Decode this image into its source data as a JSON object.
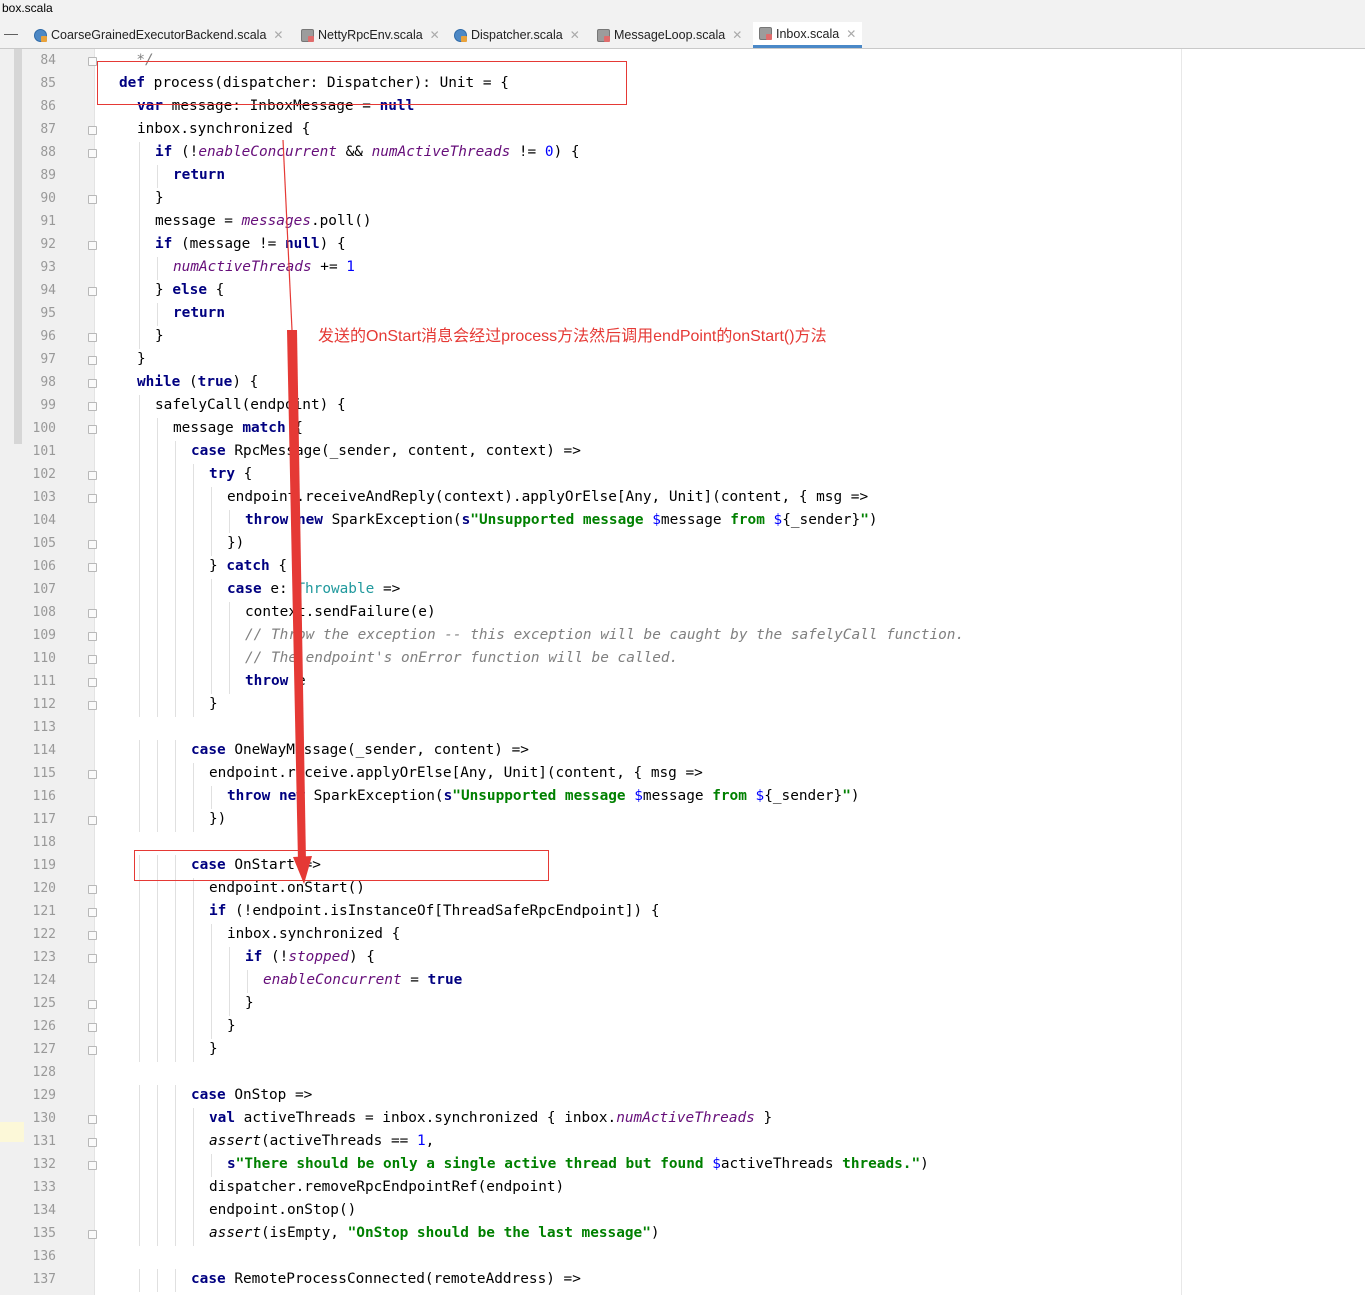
{
  "window": {
    "title": "box.scala"
  },
  "tabs": [
    {
      "label": "CoarseGrainedExecutorBackend.scala",
      "icon": "scala-class-icon",
      "active": false
    },
    {
      "label": "NettyRpcEnv.scala",
      "icon": "scala-object-icon",
      "active": false
    },
    {
      "label": "Dispatcher.scala",
      "icon": "scala-class-icon",
      "active": false
    },
    {
      "label": "MessageLoop.scala",
      "icon": "scala-object-icon",
      "active": false
    },
    {
      "label": "Inbox.scala",
      "icon": "scala-object-icon",
      "active": true
    }
  ],
  "annotation": {
    "text": "发送的OnStart消息会经过process方法然后调用endPoint的onStart()方法",
    "color": "#e53935"
  },
  "colors": {
    "keyword": "#000080",
    "field": "#660e7a",
    "number": "#0000ff",
    "string": "#008000",
    "comment": "#808080",
    "type": "#20999d",
    "annotation": "#e53935",
    "active_tab_underline": "#4a88c7"
  },
  "code_lines": [
    {
      "n": "84",
      "fold": true,
      "indent": 0,
      "t": [
        [
          "cmt",
          "  */"
        ]
      ]
    },
    {
      "n": "85",
      "fold": false,
      "indent": 0,
      "t": [
        [
          "kw",
          "def "
        ],
        [
          "",
          "process(dispatcher: Dispatcher): Unit = {"
        ]
      ]
    },
    {
      "n": "86",
      "fold": false,
      "indent": 1,
      "t": [
        [
          "kw",
          "var "
        ],
        [
          "",
          "message: InboxMessage = "
        ],
        [
          "kw",
          "null"
        ]
      ]
    },
    {
      "n": "87",
      "fold": true,
      "indent": 1,
      "t": [
        [
          "",
          "inbox.synchronized {"
        ]
      ]
    },
    {
      "n": "88",
      "fold": true,
      "indent": 2,
      "t": [
        [
          "kw",
          "if "
        ],
        [
          "",
          "(!"
        ],
        [
          "fld",
          "enableConcurrent"
        ],
        [
          "",
          " && "
        ],
        [
          "fld",
          "numActiveThreads"
        ],
        [
          "",
          " != "
        ],
        [
          "num",
          "0"
        ],
        [
          "",
          ") {"
        ]
      ]
    },
    {
      "n": "89",
      "fold": false,
      "indent": 3,
      "t": [
        [
          "kw",
          "return"
        ]
      ]
    },
    {
      "n": "90",
      "fold": true,
      "indent": 2,
      "t": [
        [
          "",
          "}"
        ]
      ]
    },
    {
      "n": "91",
      "fold": false,
      "indent": 2,
      "t": [
        [
          "",
          "message = "
        ],
        [
          "fld",
          "messages"
        ],
        [
          "",
          ".poll()"
        ]
      ]
    },
    {
      "n": "92",
      "fold": true,
      "indent": 2,
      "t": [
        [
          "kw",
          "if "
        ],
        [
          "",
          "(message != "
        ],
        [
          "kw",
          "null"
        ],
        [
          "",
          ") {"
        ]
      ]
    },
    {
      "n": "93",
      "fold": false,
      "indent": 3,
      "t": [
        [
          "fld",
          "numActiveThreads"
        ],
        [
          "",
          " += "
        ],
        [
          "num",
          "1"
        ]
      ]
    },
    {
      "n": "94",
      "fold": true,
      "indent": 2,
      "t": [
        [
          "",
          "} "
        ],
        [
          "kw",
          "else "
        ],
        [
          "",
          "{"
        ]
      ]
    },
    {
      "n": "95",
      "fold": false,
      "indent": 3,
      "t": [
        [
          "kw",
          "return"
        ]
      ]
    },
    {
      "n": "96",
      "fold": true,
      "indent": 2,
      "t": [
        [
          "",
          "}"
        ]
      ]
    },
    {
      "n": "97",
      "fold": true,
      "indent": 1,
      "t": [
        [
          "",
          "}"
        ]
      ]
    },
    {
      "n": "98",
      "fold": true,
      "indent": 1,
      "t": [
        [
          "kw",
          "while "
        ],
        [
          "",
          "("
        ],
        [
          "kw",
          "true"
        ],
        [
          "",
          ") {"
        ]
      ]
    },
    {
      "n": "99",
      "fold": true,
      "indent": 2,
      "t": [
        [
          "",
          "safelyCall(endpoint) {"
        ]
      ]
    },
    {
      "n": "100",
      "fold": true,
      "indent": 3,
      "t": [
        [
          "",
          "message "
        ],
        [
          "kw",
          "match "
        ],
        [
          "",
          "{"
        ]
      ]
    },
    {
      "n": "101",
      "fold": false,
      "indent": 4,
      "t": [
        [
          "kw",
          "case "
        ],
        [
          "",
          "RpcMessage(_sender, content, context) =>"
        ]
      ]
    },
    {
      "n": "102",
      "fold": true,
      "indent": 5,
      "t": [
        [
          "kw",
          "try "
        ],
        [
          "",
          "{"
        ]
      ]
    },
    {
      "n": "103",
      "fold": true,
      "indent": 6,
      "t": [
        [
          "",
          "endpoint.receiveAndReply(context).applyOrElse[Any, Unit](content, { msg =>"
        ]
      ]
    },
    {
      "n": "104",
      "fold": false,
      "indent": 7,
      "t": [
        [
          "kw",
          "throw new "
        ],
        [
          "",
          "SparkException("
        ],
        [
          "kw",
          "s"
        ],
        [
          "str",
          "\"Unsupported message "
        ],
        [
          "num",
          "$"
        ],
        [
          "",
          "message "
        ],
        [
          "str",
          "from "
        ],
        [
          "num",
          "$"
        ],
        [
          "",
          "{_sender}"
        ],
        [
          "str",
          "\""
        ],
        [
          "",
          ")"
        ]
      ]
    },
    {
      "n": "105",
      "fold": true,
      "indent": 6,
      "t": [
        [
          "",
          "})"
        ]
      ]
    },
    {
      "n": "106",
      "fold": true,
      "indent": 5,
      "t": [
        [
          "",
          "} "
        ],
        [
          "kw",
          "catch "
        ],
        [
          "",
          "{"
        ]
      ]
    },
    {
      "n": "107",
      "fold": false,
      "indent": 6,
      "t": [
        [
          "kw",
          "case "
        ],
        [
          "",
          "e: "
        ],
        [
          "typ",
          "Throwable"
        ],
        [
          "",
          " =>"
        ]
      ]
    },
    {
      "n": "108",
      "fold": true,
      "indent": 7,
      "t": [
        [
          "",
          "context.sendFailure(e)"
        ]
      ]
    },
    {
      "n": "109",
      "fold": true,
      "indent": 7,
      "t": [
        [
          "cmt",
          "// Throw the exception -- this exception will be caught by the safelyCall function."
        ]
      ]
    },
    {
      "n": "110",
      "fold": true,
      "indent": 7,
      "t": [
        [
          "cmt",
          "// The endpoint's onError function will be called."
        ]
      ]
    },
    {
      "n": "111",
      "fold": true,
      "indent": 7,
      "t": [
        [
          "kw",
          "throw "
        ],
        [
          "",
          "e"
        ]
      ]
    },
    {
      "n": "112",
      "fold": true,
      "indent": 5,
      "t": [
        [
          "",
          "}"
        ]
      ]
    },
    {
      "n": "113",
      "fold": false,
      "indent": 0,
      "t": []
    },
    {
      "n": "114",
      "fold": false,
      "indent": 4,
      "t": [
        [
          "kw",
          "case "
        ],
        [
          "",
          "OneWayMessage(_sender, content) =>"
        ]
      ]
    },
    {
      "n": "115",
      "fold": true,
      "indent": 5,
      "t": [
        [
          "",
          "endpoint.receive.applyOrElse[Any, Unit](content, { msg =>"
        ]
      ]
    },
    {
      "n": "116",
      "fold": false,
      "indent": 6,
      "t": [
        [
          "kw",
          "throw new "
        ],
        [
          "",
          "SparkException("
        ],
        [
          "kw",
          "s"
        ],
        [
          "str",
          "\"Unsupported message "
        ],
        [
          "num",
          "$"
        ],
        [
          "",
          "message "
        ],
        [
          "str",
          "from "
        ],
        [
          "num",
          "$"
        ],
        [
          "",
          "{_sender}"
        ],
        [
          "str",
          "\""
        ],
        [
          "",
          ")"
        ]
      ]
    },
    {
      "n": "117",
      "fold": true,
      "indent": 5,
      "t": [
        [
          "",
          "})"
        ]
      ]
    },
    {
      "n": "118",
      "fold": false,
      "indent": 0,
      "t": []
    },
    {
      "n": "119",
      "fold": false,
      "indent": 4,
      "t": [
        [
          "kw",
          "case "
        ],
        [
          "",
          "OnStart =>"
        ]
      ]
    },
    {
      "n": "120",
      "fold": true,
      "indent": 5,
      "t": [
        [
          "",
          "endpoint.onStart()"
        ]
      ]
    },
    {
      "n": "121",
      "fold": true,
      "indent": 5,
      "t": [
        [
          "kw",
          "if "
        ],
        [
          "",
          "(!endpoint.isInstanceOf[ThreadSafeRpcEndpoint]) {"
        ]
      ]
    },
    {
      "n": "122",
      "fold": true,
      "indent": 6,
      "t": [
        [
          "",
          "inbox.synchronized {"
        ]
      ]
    },
    {
      "n": "123",
      "fold": true,
      "indent": 7,
      "t": [
        [
          "kw",
          "if "
        ],
        [
          "",
          "(!"
        ],
        [
          "fld",
          "stopped"
        ],
        [
          "",
          ") {"
        ]
      ]
    },
    {
      "n": "124",
      "fold": false,
      "indent": 8,
      "t": [
        [
          "fld",
          "enableConcurrent"
        ],
        [
          "",
          " = "
        ],
        [
          "kw",
          "true"
        ]
      ]
    },
    {
      "n": "125",
      "fold": true,
      "indent": 7,
      "t": [
        [
          "",
          "}"
        ]
      ]
    },
    {
      "n": "126",
      "fold": true,
      "indent": 6,
      "t": [
        [
          "",
          "}"
        ]
      ]
    },
    {
      "n": "127",
      "fold": true,
      "indent": 5,
      "t": [
        [
          "",
          "}"
        ]
      ]
    },
    {
      "n": "128",
      "fold": false,
      "indent": 0,
      "t": []
    },
    {
      "n": "129",
      "fold": false,
      "indent": 4,
      "t": [
        [
          "kw",
          "case "
        ],
        [
          "",
          "OnStop =>"
        ]
      ]
    },
    {
      "n": "130",
      "fold": true,
      "indent": 5,
      "t": [
        [
          "kw",
          "val "
        ],
        [
          "",
          "activeThreads = inbox.synchronized { inbox."
        ],
        [
          "fld",
          "numActiveThreads"
        ],
        [
          "",
          " }"
        ]
      ]
    },
    {
      "n": "131",
      "fold": true,
      "indent": 5,
      "t": [
        [
          "ital",
          "assert"
        ],
        [
          "",
          "(activeThreads == "
        ],
        [
          "num",
          "1"
        ],
        [
          "",
          ","
        ]
      ]
    },
    {
      "n": "132",
      "fold": true,
      "indent": 6,
      "t": [
        [
          "kw",
          "s"
        ],
        [
          "str",
          "\"There should be only a single active thread but found "
        ],
        [
          "num",
          "$"
        ],
        [
          "",
          "activeThreads "
        ],
        [
          "str",
          "threads.\""
        ],
        [
          "",
          ")"
        ]
      ]
    },
    {
      "n": "133",
      "fold": false,
      "indent": 5,
      "t": [
        [
          "",
          "dispatcher.removeRpcEndpointRef(endpoint)"
        ]
      ]
    },
    {
      "n": "134",
      "fold": false,
      "indent": 5,
      "t": [
        [
          "",
          "endpoint.onStop()"
        ]
      ]
    },
    {
      "n": "135",
      "fold": true,
      "indent": 5,
      "t": [
        [
          "ital",
          "assert"
        ],
        [
          "",
          "(isEmpty, "
        ],
        [
          "str",
          "\"OnStop should be the last message\""
        ],
        [
          "",
          ")"
        ]
      ]
    },
    {
      "n": "136",
      "fold": false,
      "indent": 0,
      "t": []
    },
    {
      "n": "137",
      "fold": false,
      "indent": 4,
      "t": [
        [
          "kw",
          "case "
        ],
        [
          "",
          "RemoteProcessConnected(remoteAddress) =>"
        ]
      ]
    }
  ]
}
